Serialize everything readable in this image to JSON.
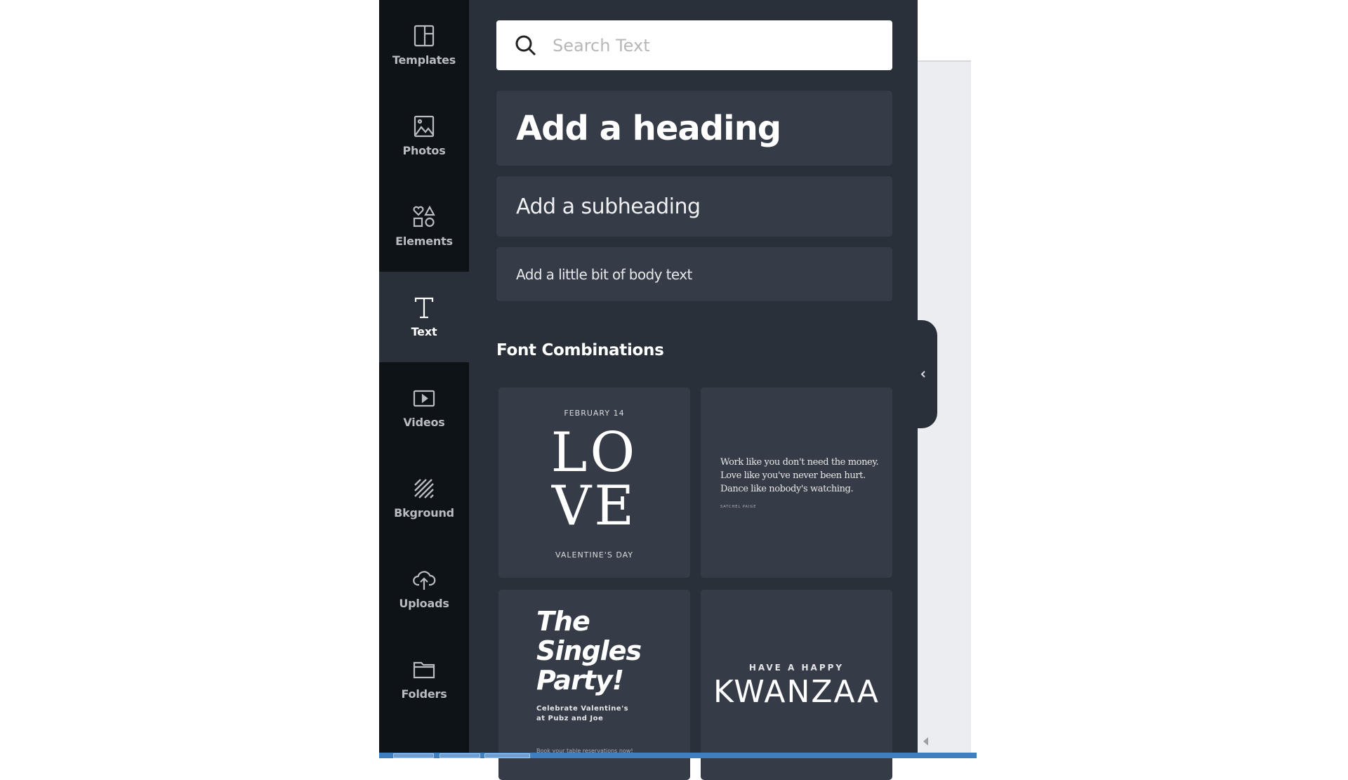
{
  "sidebar": {
    "items": [
      {
        "label": "Templates",
        "icon": "templates-icon",
        "active": false
      },
      {
        "label": "Photos",
        "icon": "photos-icon",
        "active": false
      },
      {
        "label": "Elements",
        "icon": "elements-icon",
        "active": false
      },
      {
        "label": "Text",
        "icon": "text-icon",
        "active": true
      },
      {
        "label": "Videos",
        "icon": "videos-icon",
        "active": false
      },
      {
        "label": "Bkground",
        "icon": "background-icon",
        "active": false
      },
      {
        "label": "Uploads",
        "icon": "uploads-icon",
        "active": false
      },
      {
        "label": "Folders",
        "icon": "folders-icon",
        "active": false
      }
    ]
  },
  "panel": {
    "search": {
      "placeholder": "Search Text",
      "value": ""
    },
    "add_heading": "Add a heading",
    "add_subheading": "Add a subheading",
    "add_body": "Add a little bit of body text",
    "section_title": "Font Combinations",
    "combinations": [
      {
        "top": "FEBRUARY 14",
        "main": "LO\nVE",
        "bottom": "VALENTINE'S DAY"
      },
      {
        "quote": "Work like you don't need the money.\nLove like you've never been hurt.\nDance like nobody's watching.",
        "attribution": "SATCHEL PAIGE"
      },
      {
        "title": "The\nSingles\nParty!",
        "subtitle": "Celebrate Valentine's\nat Pubz and Joe",
        "footer": "Book your table reservations now!"
      },
      {
        "small": "HAVE A HAPPY",
        "big": "KWANZAA"
      }
    ]
  },
  "colors": {
    "sidebar_bg": "#0e1318",
    "panel_bg": "#293039",
    "button_bg": "#363c47",
    "taskbar": "#3f7fc0"
  }
}
